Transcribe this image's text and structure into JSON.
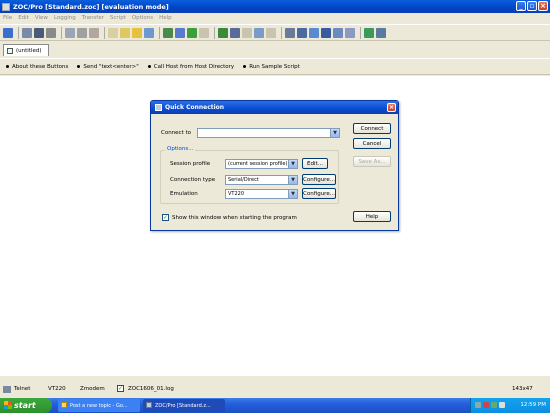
{
  "window": {
    "title": "ZOC/Pro [Standard.zoc] [evaluation mode]",
    "controls": {
      "minimize": "_",
      "maximize": "▫",
      "close": "×"
    }
  },
  "menu": [
    "File",
    "Edit",
    "View",
    "Logging",
    "Transfer",
    "Script",
    "Options",
    "Help"
  ],
  "tab": {
    "label": "(untitled)"
  },
  "buttonbar": [
    "About these Buttons",
    "Send \"text<enter>\"",
    "Call Host from Host Directory",
    "Run Sample Script"
  ],
  "dialog": {
    "title": "Quick Connection",
    "connect_to_label": "Connect to",
    "connect_to_value": "",
    "options_legend": "Options...",
    "session_profile_label": "Session profile",
    "session_profile_value": "(current session profile)",
    "connection_type_label": "Connection type",
    "connection_type_value": "Serial/Direct",
    "emulation_label": "Emulation",
    "emulation_value": "VT220",
    "edit_button": "Edit...",
    "configure_button_1": "Configure...",
    "configure_button_2": "Configure...",
    "connect_button": "Connect",
    "cancel_button": "Cancel",
    "save_as_button": "Save As...",
    "help_button": "Help",
    "show_window_label": "Show this window when starting the program",
    "show_window_checked": true
  },
  "statusbar": {
    "connection": "Telnet",
    "emulation": "VT220",
    "transfer": "Zmodem",
    "logfile": "ZOC1606_01.log",
    "size": "143x47"
  },
  "taskbar": {
    "start": "start",
    "tasks": [
      "Post a new topic - Go...",
      "ZOC/Pro [Standard.z..."
    ],
    "clock": "12:59 PM"
  },
  "colors": {
    "accent": "#0a4bd0",
    "taskbar": "#245edb",
    "start": "#2c8f2c"
  }
}
